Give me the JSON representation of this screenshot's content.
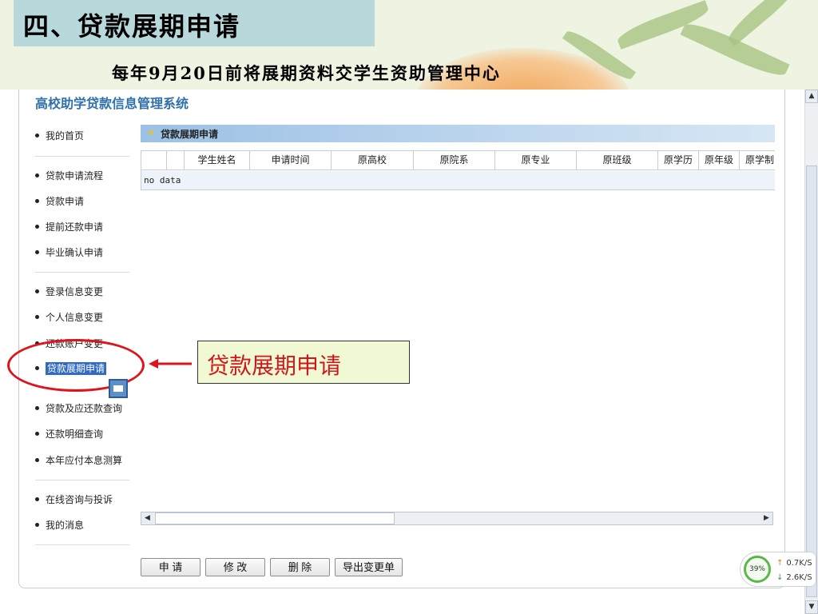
{
  "slide": {
    "title": "四、贷款展期申请",
    "subtitle": "每年9月20日前将展期资料交学生资助管理中心"
  },
  "app": {
    "system_title": "高校助学贷款信息管理系统",
    "sidebar": {
      "items": [
        {
          "label": "我的首页"
        },
        {
          "label": "贷款申请流程"
        },
        {
          "label": "贷款申请"
        },
        {
          "label": "提前还款申请"
        },
        {
          "label": "毕业确认申请"
        },
        {
          "label": "登录信息变更"
        },
        {
          "label": "个人信息变更"
        },
        {
          "label": "还款账户变更"
        },
        {
          "label": "贷款展期申请",
          "active": true
        },
        {
          "label": "贷款及应还款查询"
        },
        {
          "label": "还款明细查询"
        },
        {
          "label": "本年应付本息测算"
        },
        {
          "label": "在线咨询与投诉"
        },
        {
          "label": "我的消息"
        }
      ]
    },
    "panel": {
      "title": "贷款展期申请",
      "columns": [
        "学生姓名",
        "申请时间",
        "原高校",
        "原院系",
        "原专业",
        "原班级",
        "原学历",
        "原年级",
        "原学制"
      ],
      "empty_text": "no data"
    },
    "buttons": {
      "apply": "申 请",
      "edit": "修 改",
      "delete": "删 除",
      "export": "导出变更单"
    }
  },
  "annotation": {
    "callout": "贷款展期申请",
    "highlight_color": "#e0121b"
  },
  "network_widget": {
    "percent": "39%",
    "upload": "0.7K/S",
    "download": "2.6K/S"
  }
}
